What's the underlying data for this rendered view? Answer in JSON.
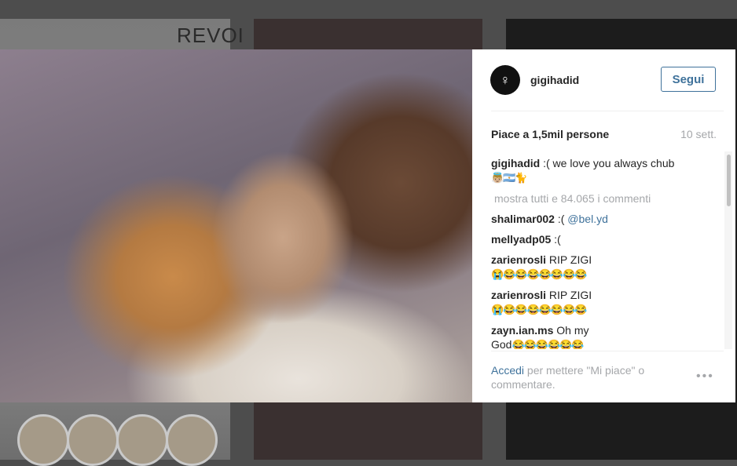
{
  "background": {
    "fragment_text": "REVOI"
  },
  "post": {
    "username": "gigihadid",
    "follow_label": "Segui",
    "likes": "Piace a 1,5mil persone",
    "time": "10 sett.",
    "caption": {
      "user": "gigihadid",
      "text": ":( we love you always chub",
      "emoji": "👼🏼🇦🇷🐈"
    },
    "show_all_comments": "mostra tutti e 84.065 i commenti",
    "comments": [
      {
        "user": "shalimar002",
        "text": ":(",
        "mention": "@bel.yd",
        "emoji": ""
      },
      {
        "user": "mellyadp05",
        "text": ":(",
        "mention": "",
        "emoji": ""
      },
      {
        "user": "zarienrosli",
        "text": "RIP ZIGI",
        "mention": "",
        "emoji": "😭😂😂😂😂😂😂😂"
      },
      {
        "user": "zarienrosli",
        "text": "RIP ZIGI",
        "mention": "",
        "emoji": "😭😂😂😂😂😂😂😂"
      },
      {
        "user": "zayn.ian.ms",
        "text": "Oh my",
        "text2": "God",
        "mention": "",
        "emoji": "😂😂😂😂😂😂"
      }
    ],
    "footer": {
      "login_link": "Accedi",
      "login_text": "per mettere \"Mi piace\" o commentare."
    },
    "more_icon": "more-options-icon"
  }
}
